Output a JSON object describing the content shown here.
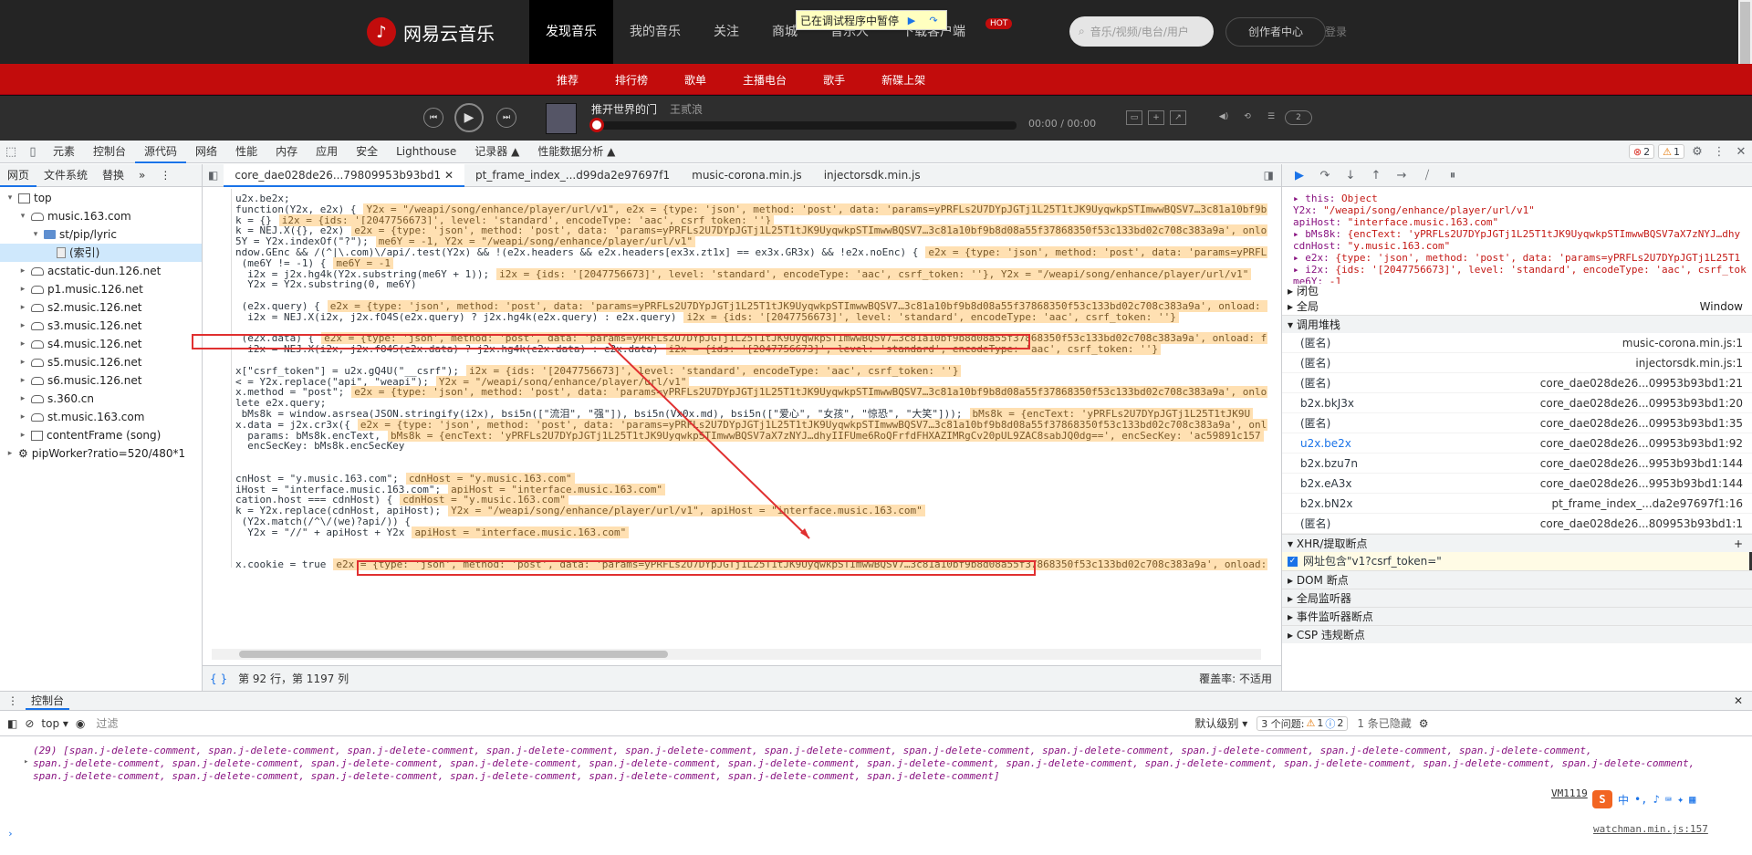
{
  "site": {
    "logo_text": "网易云音乐",
    "nav": [
      "发现音乐",
      "我的音乐",
      "关注",
      "商城",
      "音乐人",
      "下载客户端"
    ],
    "hot_badge": "HOT",
    "search_placeholder": "音乐/视频/电台/用户",
    "creator_center": "创作者中心",
    "login": "登录",
    "subnav": [
      "推荐",
      "排行榜",
      "歌单",
      "主播电台",
      "歌手",
      "新碟上架"
    ],
    "paused_label": "已在调试程序中暂停"
  },
  "player": {
    "song_title": "推开世界的门",
    "artist": "王贰浪",
    "time": "00:00 / 00:00",
    "count": "2"
  },
  "devtools": {
    "tabs": [
      "元素",
      "控制台",
      "源代码",
      "网络",
      "性能",
      "内存",
      "应用",
      "安全",
      "Lighthouse",
      "记录器 ▲",
      "性能数据分析 ▲"
    ],
    "errors": "2",
    "warnings": "1",
    "navigator_tabs": [
      "网页",
      "文件系统",
      "替换"
    ],
    "tree": [
      {
        "label": "top",
        "indent": 0,
        "kind": "frame"
      },
      {
        "label": "music.163.com",
        "indent": 1,
        "kind": "cloud"
      },
      {
        "label": "st/pip/lyric",
        "indent": 2,
        "kind": "folder"
      },
      {
        "label": "(索引)",
        "indent": 3,
        "kind": "file"
      },
      {
        "label": "acstatic-dun.126.net",
        "indent": 1,
        "kind": "cloud"
      },
      {
        "label": "p1.music.126.net",
        "indent": 1,
        "kind": "cloud"
      },
      {
        "label": "s2.music.126.net",
        "indent": 1,
        "kind": "cloud"
      },
      {
        "label": "s3.music.126.net",
        "indent": 1,
        "kind": "cloud"
      },
      {
        "label": "s4.music.126.net",
        "indent": 1,
        "kind": "cloud"
      },
      {
        "label": "s5.music.126.net",
        "indent": 1,
        "kind": "cloud"
      },
      {
        "label": "s6.music.126.net",
        "indent": 1,
        "kind": "cloud"
      },
      {
        "label": "s.360.cn",
        "indent": 1,
        "kind": "cloud"
      },
      {
        "label": "st.music.163.com",
        "indent": 1,
        "kind": "cloud"
      },
      {
        "label": "contentFrame (song)",
        "indent": 1,
        "kind": "frame"
      },
      {
        "label": "pipWorker?ratio=520/480*1",
        "indent": 0,
        "kind": "gear"
      }
    ],
    "editor_tabs": [
      "core_dae028de26...79809953b93bd1",
      "pt_frame_index_...d99da2e97697f1",
      "music-corona.min.js",
      "injectorsdk.min.js"
    ],
    "code_lines": [
      {
        "code": "u2x.be2x;",
        "ann": ""
      },
      {
        "code": "function(Y2x, e2x) {",
        "ann": "Y2x = \"/weapi/song/enhance/player/url/v1\", e2x = {type: 'json', method: 'post', data: 'params=yPRFLs2U7DYpJGTj1L25T1tJK9UyqwkpSTImwwBQSV7…3c81a10bf9b8"
      },
      {
        "code": "k = {}",
        "ann": "i2x = {ids: '[2047756673]', level: 'standard', encodeType: 'aac', csrf_token: ''}"
      },
      {
        "code": "k = NEJ.X({}, e2x)",
        "ann": "e2x = {type: 'json', method: 'post', data: 'params=yPRFLs2U7DYpJGTj1L25T1tJK9UyqwkpSTImwwBQSV7…3c81a10bf9b8d08a55f37868350f53c133bd02c708c383a9a', onload"
      },
      {
        "code": "5Y = Y2x.indexOf(\"?\");",
        "ann": "me6Y = -1, Y2x = \"/weapi/song/enhance/player/url/v1\""
      },
      {
        "code": "ndow.GEnc && /(^|\\.com)\\/api/.test(Y2x) && !(e2x.headers && e2x.headers[ex3x.zt1x] == ex3x.GR3x) && !e2x.noEnc) {",
        "ann": "e2x = {type: 'json', method: 'post', data: 'params=yPRFL"
      },
      {
        "code": " (me6Y != -1) {",
        "ann": "me6Y = -1"
      },
      {
        "code": "  i2x = j2x.hg4k(Y2x.substring(me6Y + 1));",
        "ann": "i2x = {ids: '[2047756673]', level: 'standard', encodeType: 'aac', csrf_token: ''}, Y2x = \"/weapi/song/enhance/player/url/v1\""
      },
      {
        "code": "  Y2x = Y2x.substring(0, me6Y)",
        "ann": ""
      },
      {
        "code": "",
        "ann": ""
      },
      {
        "code": " (e2x.query) {",
        "ann": "e2x = {type: 'json', method: 'post', data: 'params=yPRFLs2U7DYpJGTj1L25T1tJK9UyqwkpSTImwwBQSV7…3c81a10bf9b8d08a55f37868350f53c133bd02c708c383a9a', onload: f"
      },
      {
        "code": "  i2x = NEJ.X(i2x, j2x.fO4S(e2x.query) ? j2x.hg4k(e2x.query) : e2x.query)",
        "ann": "i2x = {ids: '[2047756673]', level: 'standard', encodeType: 'aac', csrf_token: ''}"
      },
      {
        "code": "",
        "ann": ""
      },
      {
        "code": " (e2x.data) {",
        "ann": "e2x = {type: 'json', method: 'post', data: 'params=yPRFLs2U7DYpJGTj1L25T1tJK9UyqwkpSTImwwBQSV7…3c81a10bf9b8d08a55f37868350f53c133bd02c708c383a9a', onload: f"
      },
      {
        "code": "  i2x = NEJ.X(i2x, j2x.fO4S(e2x.data) ? j2x.hg4k(e2x.data) : e2x.data)",
        "ann": "i2x = {ids: '[2047756673]', level: 'standard', encodeType: 'aac', csrf_token: ''}"
      },
      {
        "code": "",
        "ann": ""
      },
      {
        "code": "x[\"csrf_token\"] = u2x.gQ4U(\"__csrf\");",
        "ann": "i2x = {ids: '[2047756673]', level: 'standard', encodeType: 'aac', csrf_token: ''}"
      },
      {
        "code": "< = Y2x.replace(\"api\", \"weapi\");",
        "ann": "Y2x = \"/weapi/song/enhance/player/url/v1\""
      },
      {
        "code": "x.method = \"post\";",
        "ann": "e2x = {type: 'json', method: 'post', data: 'params=yPRFLs2U7DYpJGTj1L25T1tJK9UyqwkpSTImwwBQSV7…3c81a10bf9b8d08a55f37868350f53c133bd02c708c383a9a', onload: f"
      },
      {
        "code": "lete e2x.query;",
        "ann": ""
      },
      {
        "code": " bMs8k = window.asrsea(JSON.stringify(i2x), bsi5n([\"流泪\", \"强\"]), bsi5n(Vx0x.md), bsi5n([\"爱心\", \"女孩\", \"惊恐\", \"大笑\"]));",
        "ann": "bMs8k = {encText: 'yPRFLs2U7DYpJGTj1L25T1tJK9U"
      },
      {
        "code": "x.data = j2x.cr3x({",
        "ann": "e2x = {type: 'json', method: 'post', data: 'params=yPRFLs2U7DYpJGTj1L25T1tJK9UyqwkpSTImwwBQSV7…3c81a10bf9b8d08a55f37868350f53c133bd02c708c383a9a', onl"
      },
      {
        "code": "  params: bMs8k.encText,",
        "ann": "bMs8k = {encText: 'yPRFLs2U7DYpJGTj1L25T1tJK9UyqwkpSTImwwBQSV7aX7zNYJ…dhyIIFUme6RoQFrfdFHXAZIMRgCv20pUL9ZAC8sabJQ0dg==', encSecKey: 'ac59891c157"
      },
      {
        "code": "  encSecKey: bMs8k.encSecKey",
        "ann": ""
      },
      {
        "code": "",
        "ann": ""
      },
      {
        "code": "",
        "ann": ""
      },
      {
        "code": "cnHost = \"y.music.163.com\";",
        "ann": "cdnHost = \"y.music.163.com\""
      },
      {
        "code": "iHost = \"interface.music.163.com\";",
        "ann": "apiHost = \"interface.music.163.com\""
      },
      {
        "code": "cation.host === cdnHost) {",
        "ann": "cdnHost = \"y.music.163.com\""
      },
      {
        "code": "k = Y2x.replace(cdnHost, apiHost);",
        "ann": "Y2x = \"/weapi/song/enhance/player/url/v1\", apiHost = \"interface.music.163.com\""
      },
      {
        "code": " (Y2x.match(/^\\/(we)?api/)) {",
        "ann": ""
      },
      {
        "code": "  Y2x = \"//\" + apiHost + Y2x",
        "ann": "apiHost = \"interface.music.163.com\""
      },
      {
        "code": "",
        "ann": ""
      },
      {
        "code": "",
        "ann": ""
      },
      {
        "code": "x.cookie = true",
        "ann": "e2x = {type: 'json', method: 'post', data: 'params=yPRFLs2U7DYpJGTj1L25T1tJK9UyqwkpSTImwwBQSV7…3c81a10bf9b8d08a55f37868350f53c133bd02c708c383a9a', onload:"
      }
    ],
    "status_position": "第 92 行，第 1197 列",
    "status_coverage": "覆盖率: 不适用",
    "scope": [
      {
        "k": "▸ this:",
        "v": " Object"
      },
      {
        "k": "  Y2x:",
        "v": " \"/weapi/song/enhance/player/url/v1\""
      },
      {
        "k": "  apiHost:",
        "v": " \"interface.music.163.com\""
      },
      {
        "k": "▸ bMs8k:",
        "v": " {encText: 'yPRFLs2U7DYpJGTj1L25T1tJK9UyqwkpSTImwwBQSV7aX7zNYJ…dhy"
      },
      {
        "k": "  cdnHost:",
        "v": " \"y.music.163.com\""
      },
      {
        "k": "▸ e2x:",
        "v": " {type: 'json', method: 'post', data: 'params=yPRFLs2U7DYpJGTj1L25T1"
      },
      {
        "k": "▸ i2x:",
        "v": " {ids: '[2047756673]', level: 'standard', encodeType: 'aac', csrf_tok"
      },
      {
        "k": "  me6Y:",
        "v": " -1"
      }
    ],
    "closure": "闭包",
    "global": "全局",
    "global_value": "Window",
    "call_stack_header": "调用堆栈",
    "call_stack": [
      {
        "name": "(匿名)",
        "loc": "music-corona.min.js:1"
      },
      {
        "name": "(匿名)",
        "loc": "injectorsdk.min.js:1"
      },
      {
        "name": "(匿名)",
        "loc": "core_dae028de26...09953b93bd1:21"
      },
      {
        "name": "b2x.bkJ3x",
        "loc": "core_dae028de26...09953b93bd1:20"
      },
      {
        "name": "(匿名)",
        "loc": "core_dae028de26...09953b93bd1:35"
      },
      {
        "name": "u2x.be2x",
        "loc": "core_dae028de26...09953b93bd1:92"
      },
      {
        "name": "b2x.bzu7n",
        "loc": "core_dae028de26...9953b93bd1:144"
      },
      {
        "name": "b2x.eA3x",
        "loc": "core_dae028de26...9953b93bd1:144"
      },
      {
        "name": "b2x.bN2x",
        "loc": "pt_frame_index_...da2e97697f1:16"
      },
      {
        "name": "(匿名)",
        "loc": "core_dae028de26...809953b93bd1:1"
      }
    ],
    "xhr_header": "XHR/提取断点",
    "xhr_rule": "网址包含\"v1?csrf_token=\"",
    "dom_bp": "DOM 断点",
    "global_listeners": "全局监听器",
    "event_bp": "事件监听器断点",
    "csp_bp": "CSP 违规断点"
  },
  "console": {
    "title": "控制台",
    "context": "top",
    "filter_placeholder": "过滤",
    "level": "默认级别",
    "issues_label": "3 个问题:",
    "issues_warn": "1",
    "issues_info": "2",
    "hidden": "1 条已隐藏",
    "line1": "(29) [span.j-delete-comment, span.j-delete-comment, span.j-delete-comment, span.j-delete-comment, span.j-delete-comment, span.j-delete-comment, span.j-delete-comment, span.j-delete-comment, span.j-delete-comment, span.j-delete-comment, span.j-delete-comment,",
    "line2": "span.j-delete-comment, span.j-delete-comment, span.j-delete-comment, span.j-delete-comment, span.j-delete-comment, span.j-delete-comment, span.j-delete-comment, span.j-delete-comment, span.j-delete-comment, span.j-delete-comment, span.j-delete-comment, span.j-delete-comment,",
    "line3": "span.j-delete-comment, span.j-delete-comment, span.j-delete-comment, span.j-delete-comment, span.j-delete-comment, span.j-delete-comment, span.j-delete-comment]",
    "vm_link": "VM1119",
    "watchman_link": "watchman.min.js:157",
    "ime_text": "中"
  }
}
